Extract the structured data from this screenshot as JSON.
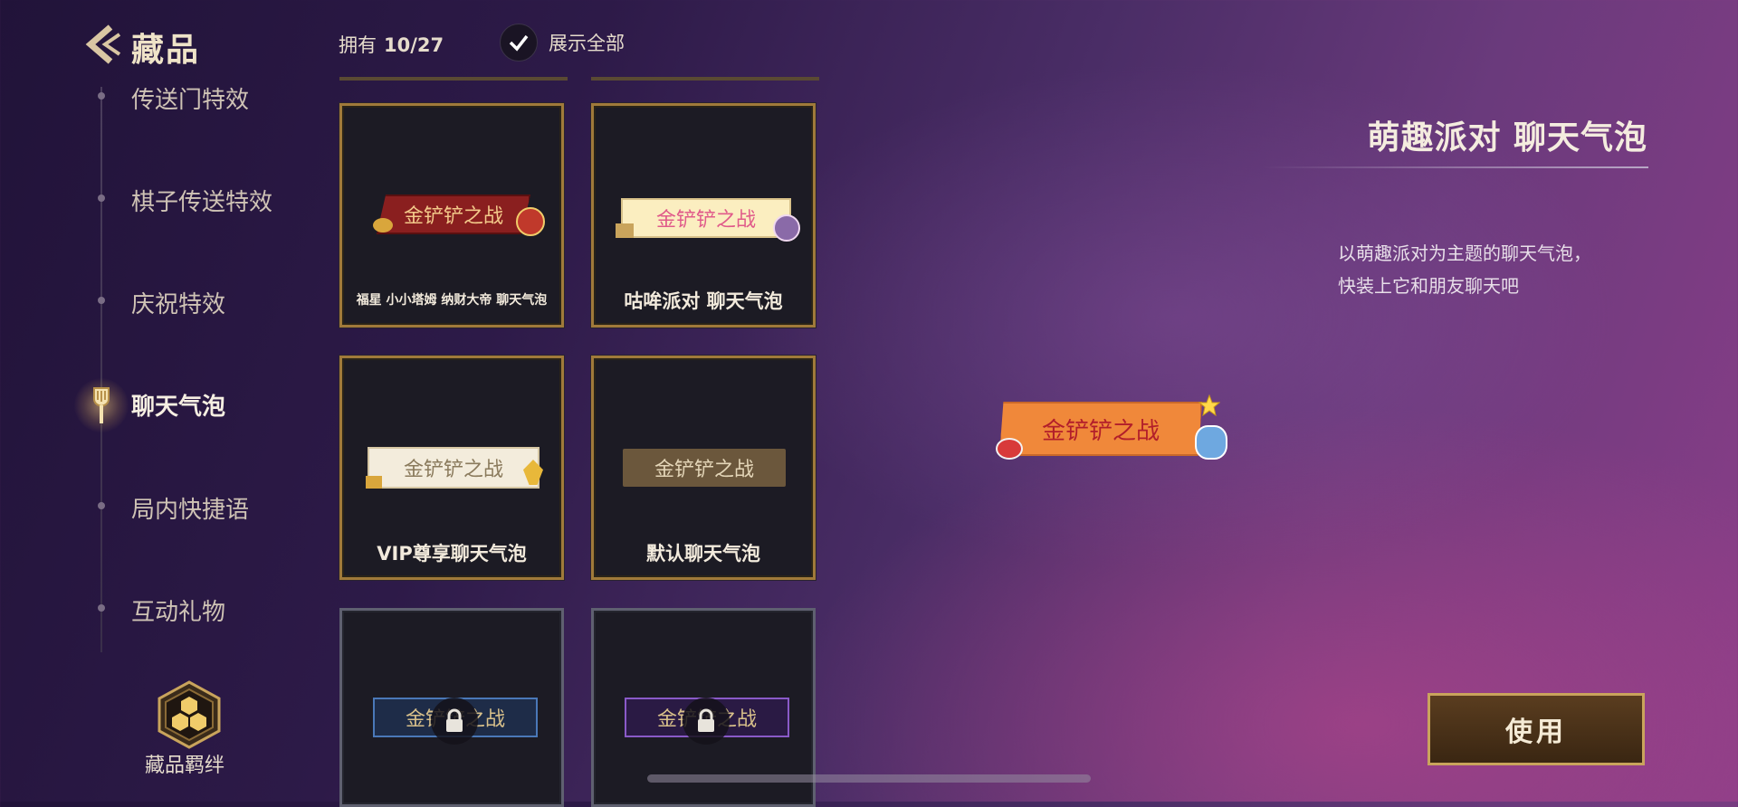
{
  "header": {
    "title": "藏品",
    "owned_label": "拥有",
    "owned_count": "10/27",
    "show_all_label": "展示全部"
  },
  "sidebar": {
    "items": [
      {
        "label": "传送门特效"
      },
      {
        "label": "棋子传送特效"
      },
      {
        "label": "庆祝特效"
      },
      {
        "label": "聊天气泡"
      },
      {
        "label": "局内快捷语"
      },
      {
        "label": "互动礼物"
      }
    ],
    "active_item": "聊天气泡",
    "bond_label": "藏品羁绊"
  },
  "grid": {
    "bubble_text": "金铲铲之战",
    "cards": [
      {
        "label": "福星 小小塔姆 纳财大帝 聊天气泡",
        "locked": false
      },
      {
        "label": "咕哞派对 聊天气泡",
        "locked": false
      },
      {
        "label": "VIP尊享聊天气泡",
        "locked": false
      },
      {
        "label": "默认聊天气泡",
        "locked": false
      },
      {
        "label": "",
        "locked": true
      },
      {
        "label": "",
        "locked": true
      }
    ]
  },
  "detail": {
    "title": "萌趣派对  聊天气泡",
    "description_line1": "以萌趣派对为主题的聊天气泡，",
    "description_line2": "快装上它和朋友聊天吧",
    "preview_text": "金铲铲之战",
    "use_button": "使用"
  },
  "colors": {
    "gold_border": "#a07a3a",
    "locked_border": "#5f6070",
    "use_button_border": "#c9a45c"
  }
}
